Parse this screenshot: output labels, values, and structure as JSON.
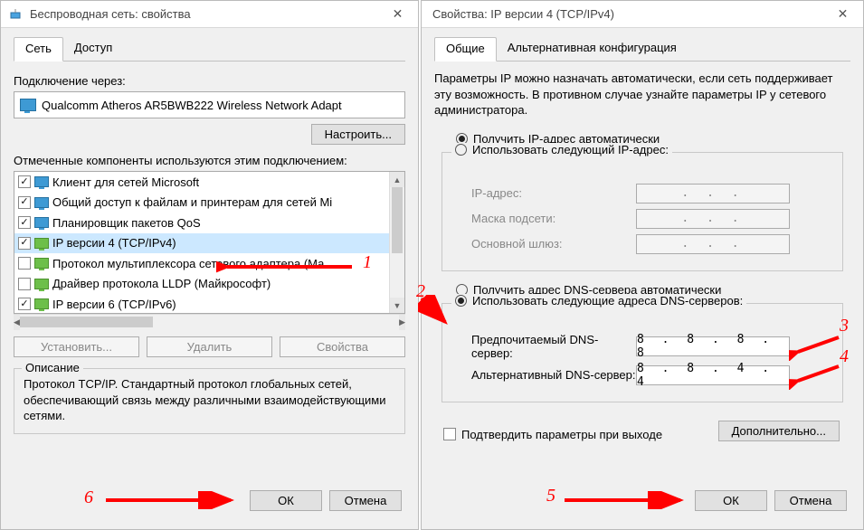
{
  "left": {
    "title": "Беспроводная сеть: свойства",
    "tabs": {
      "network": "Сеть",
      "sharing": "Доступ"
    },
    "connect_using": "Подключение через:",
    "adapter": "Qualcomm Atheros AR5BWB222 Wireless Network Adapt",
    "configure_btn": "Настроить...",
    "components_label": "Отмеченные компоненты используются этим подключением:",
    "components": [
      {
        "checked": true,
        "label": "Клиент для сетей Microsoft",
        "iconClass": ""
      },
      {
        "checked": true,
        "label": "Общий доступ к файлам и принтерам для сетей Mi",
        "iconClass": ""
      },
      {
        "checked": true,
        "label": "Планировщик пакетов QoS",
        "iconClass": ""
      },
      {
        "checked": true,
        "label": "IP версии 4 (TCP/IPv4)",
        "iconClass": "green",
        "selected": true
      },
      {
        "checked": false,
        "label": "Протокол мультиплексора сетевого адаптера (Ма",
        "iconClass": "green"
      },
      {
        "checked": false,
        "label": "Драйвер протокола LLDP (Майкрософт)",
        "iconClass": "green"
      },
      {
        "checked": true,
        "label": "IP версии 6 (TCP/IPv6)",
        "iconClass": "green"
      }
    ],
    "install_btn": "Установить...",
    "uninstall_btn": "Удалить",
    "properties_btn": "Свойства",
    "description_title": "Описание",
    "description_text": "Протокол TCP/IP. Стандартный протокол глобальных сетей, обеспечивающий связь между различными взаимодействующими сетями.",
    "ok": "ОК",
    "cancel": "Отмена"
  },
  "right": {
    "title": "Свойства: IP версии 4 (TCP/IPv4)",
    "tabs": {
      "general": "Общие",
      "alt": "Альтернативная конфигурация"
    },
    "para": "Параметры IP можно назначать автоматически, если сеть поддерживает эту возможность. В противном случае узнайте параметры IP у сетевого администратора.",
    "ip_auto": "Получить IP-адрес автоматически",
    "ip_manual": "Использовать следующий IP-адрес:",
    "ip_addr_label": "IP-адрес:",
    "mask_label": "Маска подсети:",
    "gateway_label": "Основной шлюз:",
    "dns_auto": "Получить адрес DNS-сервера автоматически",
    "dns_manual": "Использовать следующие адреса DNS-серверов:",
    "dns1_label": "Предпочитаемый DNS-сервер:",
    "dns2_label": "Альтернативный DNS-сервер:",
    "dns1_value": "8 . 8 . 8 . 8",
    "dns2_value": "8 . 8 . 4 . 4",
    "validate_label": "Подтвердить параметры при выходе",
    "advanced_btn": "Дополнительно...",
    "ok": "ОК",
    "cancel": "Отмена"
  },
  "annotations": [
    "1",
    "2",
    "3",
    "4",
    "5",
    "6"
  ]
}
